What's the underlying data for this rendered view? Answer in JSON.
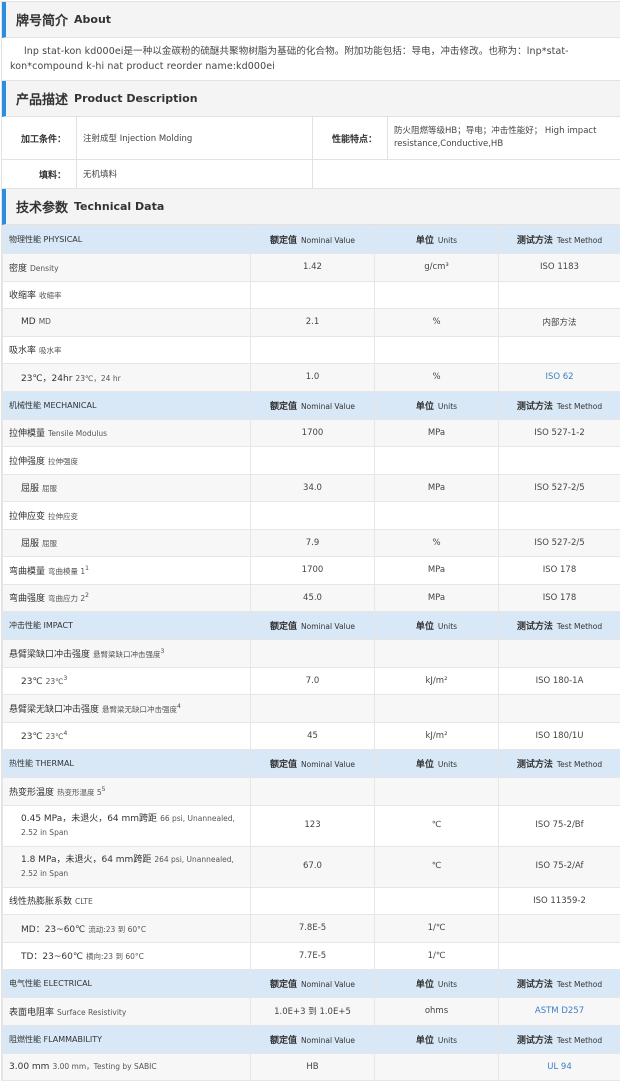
{
  "about": {
    "title_cn": "牌号简介",
    "title_en": "About",
    "text": "lnp stat-kon kd000ei是一种以金碳粉的硫醚共聚物树脂为基础的化合物。附加功能包括：导电，冲击修改。也称为：lnp*stat-kon*compound k-hi nat product reorder name:kd000ei"
  },
  "description": {
    "title_cn": "产品描述",
    "title_en": "Product Description",
    "processing_label": "加工条件：",
    "processing_value": "注射成型  Injection Molding",
    "features_label": "性能特点：",
    "features_value": "防火阻燃等级HB；导电；冲击性能好；  High impact resistance,Conductive,HB",
    "filler_label": "填料：",
    "filler_value": "无机填料"
  },
  "technical": {
    "title_cn": "技术参数",
    "title_en": "Technical Data",
    "col_nominal_cn": "额定值",
    "col_nominal_en": "Nominal Value",
    "col_units_cn": "单位",
    "col_units_en": "Units",
    "col_method_cn": "测试方法",
    "col_method_en": "Test Method",
    "categories": [
      {
        "name": "物理性能  PHYSICAL",
        "rows": [
          {
            "cn": "密度",
            "en": "Density",
            "sup": "",
            "value": "1.42",
            "unit": "g/cm³",
            "method": "ISO 1183",
            "link": false,
            "sub": false
          },
          {
            "cn": "收缩率",
            "en": "收缩率",
            "sup": "",
            "value": "",
            "unit": "",
            "method": "",
            "link": false,
            "sub": false
          },
          {
            "cn": "MD",
            "en": "MD",
            "sup": "",
            "value": "2.1",
            "unit": "%",
            "method": "内部方法",
            "link": false,
            "sub": true
          },
          {
            "cn": "吸水率",
            "en": "吸水率",
            "sup": "",
            "value": "",
            "unit": "",
            "method": "",
            "link": false,
            "sub": false
          },
          {
            "cn": "23℃，24hr",
            "en": "23℃，24 hr",
            "sup": "",
            "value": "1.0",
            "unit": "%",
            "method": "ISO 62",
            "link": true,
            "sub": true
          }
        ]
      },
      {
        "name": "机械性能  MECHANICAL",
        "rows": [
          {
            "cn": "拉伸模量",
            "en": "Tensile Modulus",
            "sup": "",
            "value": "1700",
            "unit": "MPa",
            "method": "ISO 527-1-2",
            "link": false,
            "sub": false
          },
          {
            "cn": "拉伸强度",
            "en": "拉伸强度",
            "sup": "",
            "value": "",
            "unit": "",
            "method": "",
            "link": false,
            "sub": false
          },
          {
            "cn": "屈服",
            "en": "屈服",
            "sup": "",
            "value": "34.0",
            "unit": "MPa",
            "method": "ISO 527-2/5",
            "link": false,
            "sub": true
          },
          {
            "cn": "拉伸应变",
            "en": "拉伸应变",
            "sup": "",
            "value": "",
            "unit": "",
            "method": "",
            "link": false,
            "sub": false
          },
          {
            "cn": "屈服",
            "en": "屈服",
            "sup": "",
            "value": "7.9",
            "unit": "%",
            "method": "ISO 527-2/5",
            "link": false,
            "sub": true
          },
          {
            "cn": "弯曲模量",
            "en": "弯曲模量 1",
            "sup": "1",
            "value": "1700",
            "unit": "MPa",
            "method": "ISO 178",
            "link": false,
            "sub": false
          },
          {
            "cn": "弯曲强度",
            "en": "弯曲应力 2",
            "sup": "2",
            "value": "45.0",
            "unit": "MPa",
            "method": "ISO 178",
            "link": false,
            "sub": false
          }
        ]
      },
      {
        "name": "冲击性能  IMPACT",
        "rows": [
          {
            "cn": "悬臂梁缺口冲击强度",
            "en": "悬臂梁缺口冲击强度",
            "sup": "3",
            "value": "",
            "unit": "",
            "method": "",
            "link": false,
            "sub": false
          },
          {
            "cn": "23℃",
            "en": "23℃",
            "sup": "3",
            "value": "7.0",
            "unit": "kJ/m²",
            "method": "ISO 180-1A",
            "link": false,
            "sub": true
          },
          {
            "cn": "悬臂梁无缺口冲击强度",
            "en": "悬臂梁无缺口冲击强度",
            "sup": "4",
            "value": "",
            "unit": "",
            "method": "",
            "link": false,
            "sub": false
          },
          {
            "cn": "23℃",
            "en": "23℃",
            "sup": "4",
            "value": "45",
            "unit": "kJ/m²",
            "method": "ISO 180/1U",
            "link": false,
            "sub": true
          }
        ]
      },
      {
        "name": "热性能  THERMAL",
        "rows": [
          {
            "cn": "热变形温度",
            "en": "热变形温度 5",
            "sup": "5",
            "value": "",
            "unit": "",
            "method": "",
            "link": false,
            "sub": false
          },
          {
            "cn": "0.45 MPa，未退火，64 mm跨距",
            "en": "66 psi, Unannealed, 2.52 in Span",
            "sup": "",
            "value": "123",
            "unit": "℃",
            "method": "ISO 75-2/Bf",
            "link": false,
            "sub": true,
            "tall": true
          },
          {
            "cn": "1.8 MPa，未退火，64 mm跨距",
            "en": "264 psi, Unannealed, 2.52 in Span",
            "sup": "",
            "value": "67.0",
            "unit": "℃",
            "method": "ISO 75-2/Af",
            "link": false,
            "sub": true,
            "tall": true
          },
          {
            "cn": "线性热膨胀系数",
            "en": "CLTE",
            "sup": "",
            "value": "",
            "unit": "",
            "method": "ISO 11359-2",
            "link": false,
            "sub": false
          },
          {
            "cn": "MD：23~60℃",
            "en": "流动:23 到 60°C",
            "sup": "",
            "value": "7.8E-5",
            "unit": "1/℃",
            "method": "",
            "link": false,
            "sub": true
          },
          {
            "cn": "TD：23~60℃",
            "en": "横向:23 到 60°C",
            "sup": "",
            "value": "7.7E-5",
            "unit": "1/℃",
            "method": "",
            "link": false,
            "sub": true
          }
        ]
      },
      {
        "name": "电气性能  ELECTRICAL",
        "rows": [
          {
            "cn": "表面电阻率",
            "en": "Surface Resistivity",
            "sup": "",
            "value": "1.0E+3 到 1.0E+5",
            "unit": "ohms",
            "method": "ASTM D257",
            "link": true,
            "sub": false
          }
        ]
      },
      {
        "name": "阻燃性能  FLAMMABILITY",
        "rows": [
          {
            "cn": "3.00 mm",
            "en": "3.00 mm，Testing by SABIC",
            "sup": "",
            "value": "HB",
            "unit": "",
            "method": "UL 94",
            "link": true,
            "sub": false
          }
        ]
      }
    ]
  }
}
